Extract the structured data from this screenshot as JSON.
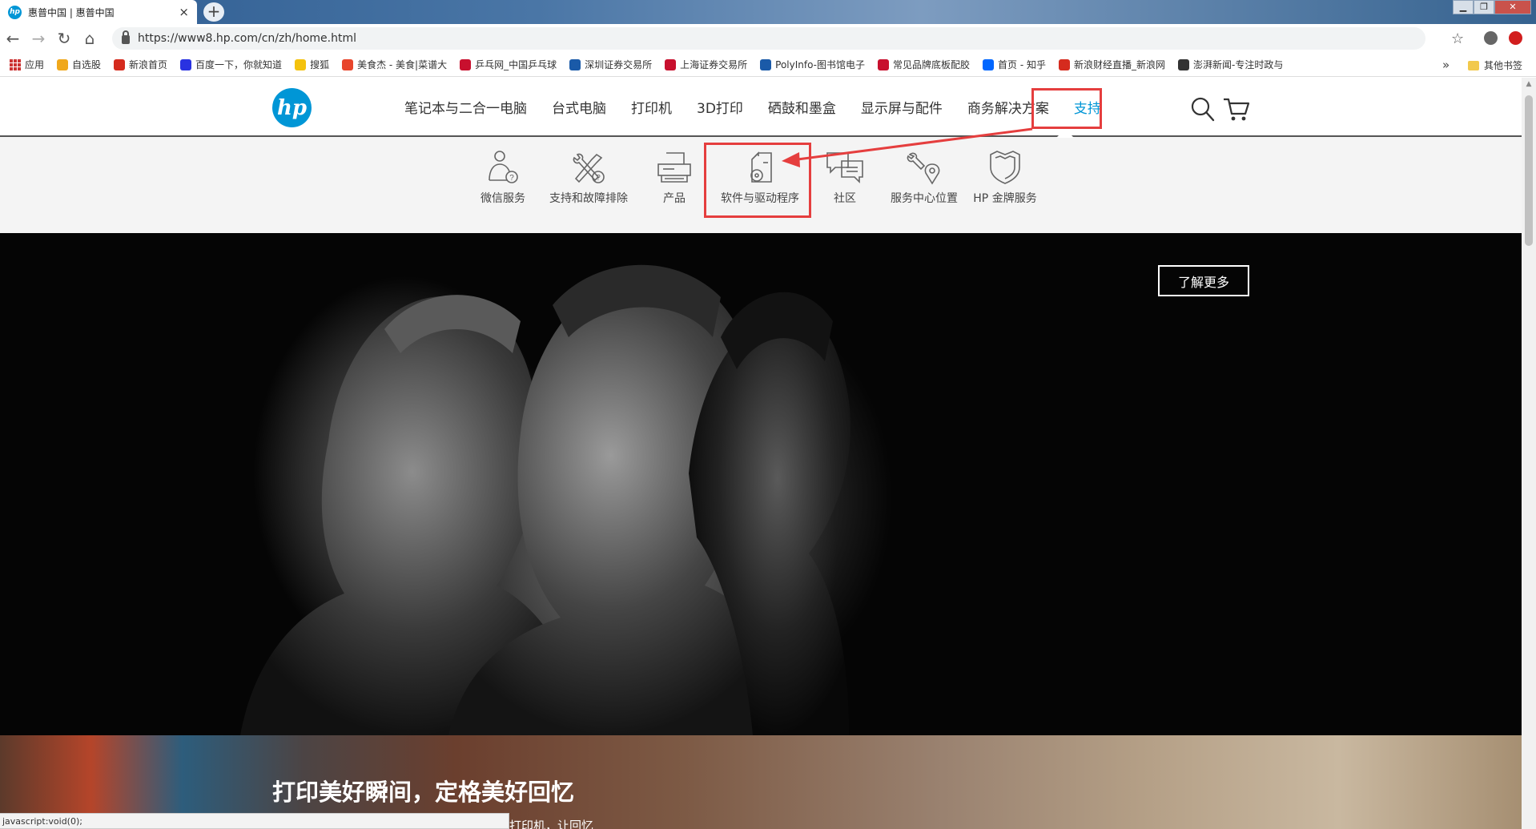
{
  "browser": {
    "tab_title": "惠普中国 | 惠普中国",
    "tab_favicon_text": "hp",
    "tab_close": "×",
    "new_tab": "+",
    "url": "https://www8.hp.com/cn/zh/home.html",
    "window_controls": {
      "minimize": "▁",
      "maximize": "❐",
      "close": "✕"
    },
    "nav": {
      "back": "←",
      "forward": "→",
      "reload": "↻",
      "home": "⌂"
    },
    "star": "☆",
    "bookmarks": [
      {
        "label": "应用",
        "color": "#c33"
      },
      {
        "label": "自选股",
        "color": "#f0a81c"
      },
      {
        "label": "新浪首页",
        "color": "#d52b1e"
      },
      {
        "label": "百度一下，你就知道",
        "color": "#2932e1"
      },
      {
        "label": "搜狐",
        "color": "#f4c20d"
      },
      {
        "label": "美食杰 - 美食|菜谱大",
        "color": "#e8452c"
      },
      {
        "label": "乒乓网_中国乒乓球",
        "color": "#c8102e"
      },
      {
        "label": "深圳证券交易所",
        "color": "#1a5aa8"
      },
      {
        "label": "上海证券交易所",
        "color": "#c8102e"
      },
      {
        "label": "PolyInfo-图书馆电子",
        "color": "#1a5aa8"
      },
      {
        "label": "常见品牌底板配胶",
        "color": "#c8102e"
      },
      {
        "label": "首页 - 知乎",
        "color": "#0066ff"
      },
      {
        "label": "新浪财经直播_新浪网",
        "color": "#d52b1e"
      },
      {
        "label": "澎湃新闻-专注时政与",
        "color": "#333333"
      }
    ],
    "bookmarks_more": "»",
    "other_bookmarks": "其他书签",
    "status_text": "javascript:void(0);"
  },
  "header": {
    "logo_text": "hp",
    "nav": [
      "笔记本与二合一电脑",
      "台式电脑",
      "打印机",
      "3D打印",
      "硒鼓和墨盒",
      "显示屏与配件",
      "商务解决方案"
    ],
    "active_nav": "支持"
  },
  "support_menu": [
    {
      "label": "微信服务",
      "icon": "wechat-service-icon"
    },
    {
      "label": "支持和故障排除",
      "icon": "troubleshoot-tools-icon"
    },
    {
      "label": "产品",
      "icon": "product-icon"
    },
    {
      "label": "软件与驱动程序",
      "icon": "software-driver-icon"
    },
    {
      "label": "社区",
      "icon": "community-chat-icon"
    },
    {
      "label": "服务中心位置",
      "icon": "service-location-icon"
    },
    {
      "label": "HP 金牌服务",
      "icon": "gold-shield-icon"
    }
  ],
  "hero": {
    "learn_more": "了解更多"
  },
  "promo": {
    "title": "打印美好瞬间，定格美好回忆",
    "subtitle": "打印机，让回忆"
  },
  "colors": {
    "hp_blue": "#0096d6",
    "highlight_red": "#e53e3e"
  }
}
